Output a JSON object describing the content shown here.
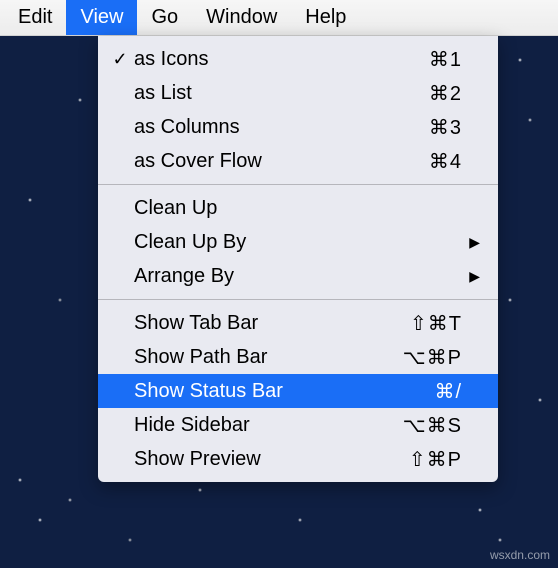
{
  "menubar": {
    "items": [
      {
        "label": "Edit",
        "active": false
      },
      {
        "label": "View",
        "active": true
      },
      {
        "label": "Go",
        "active": false
      },
      {
        "label": "Window",
        "active": false
      },
      {
        "label": "Help",
        "active": false
      }
    ]
  },
  "dropdown": {
    "groups": [
      [
        {
          "label": "as Icons",
          "checked": true,
          "shortcut": "⌘1",
          "submenu": false,
          "highlighted": false
        },
        {
          "label": "as List",
          "checked": false,
          "shortcut": "⌘2",
          "submenu": false,
          "highlighted": false
        },
        {
          "label": "as Columns",
          "checked": false,
          "shortcut": "⌘3",
          "submenu": false,
          "highlighted": false
        },
        {
          "label": "as Cover Flow",
          "checked": false,
          "shortcut": "⌘4",
          "submenu": false,
          "highlighted": false
        }
      ],
      [
        {
          "label": "Clean Up",
          "checked": false,
          "shortcut": "",
          "submenu": false,
          "highlighted": false
        },
        {
          "label": "Clean Up By",
          "checked": false,
          "shortcut": "",
          "submenu": true,
          "highlighted": false
        },
        {
          "label": "Arrange By",
          "checked": false,
          "shortcut": "",
          "submenu": true,
          "highlighted": false
        }
      ],
      [
        {
          "label": "Show Tab Bar",
          "checked": false,
          "shortcut": "⇧⌘T",
          "submenu": false,
          "highlighted": false
        },
        {
          "label": "Show Path Bar",
          "checked": false,
          "shortcut": "⌥⌘P",
          "submenu": false,
          "highlighted": false
        },
        {
          "label": "Show Status Bar",
          "checked": false,
          "shortcut": "⌘/",
          "submenu": false,
          "highlighted": true
        },
        {
          "label": "Hide Sidebar",
          "checked": false,
          "shortcut": "⌥⌘S",
          "submenu": false,
          "highlighted": false
        },
        {
          "label": "Show Preview",
          "checked": false,
          "shortcut": "⇧⌘P",
          "submenu": false,
          "highlighted": false
        }
      ]
    ]
  },
  "watermark": "wsxdn.com"
}
